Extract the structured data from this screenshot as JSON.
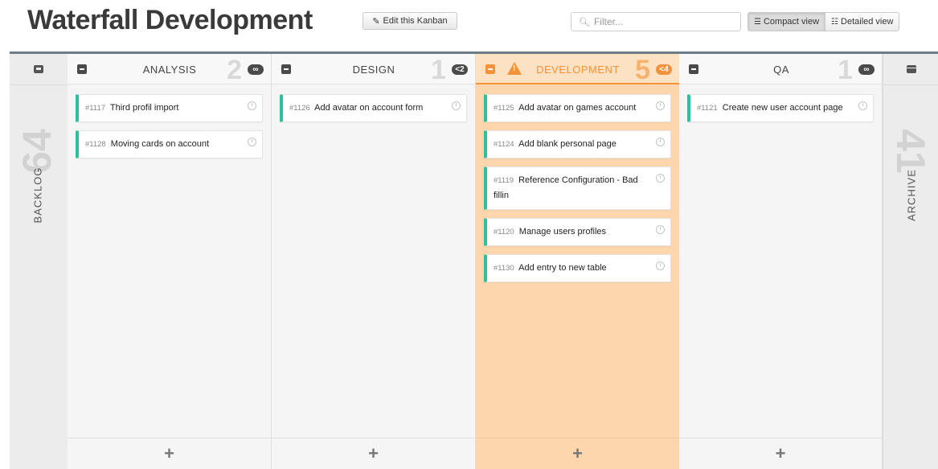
{
  "header": {
    "title": "Waterfall Development",
    "edit_label": "Edit this Kanban",
    "filter_placeholder": "Filter...",
    "views": [
      "Compact view",
      "Detailed view"
    ],
    "active_view": "Compact view"
  },
  "sides": {
    "backlog": {
      "label": "BACKLOG",
      "count": "64",
      "icon": "inbox-icon"
    },
    "archive": {
      "label": "ARCHIVE",
      "count": "41",
      "icon": "archive-icon"
    }
  },
  "columns": [
    {
      "title": "ANALYSIS",
      "count": "2",
      "limit": "∞",
      "cards": [
        {
          "id": "#1117",
          "text": "Third profil import"
        },
        {
          "id": "#1128",
          "text": "Moving cards on account"
        }
      ]
    },
    {
      "title": "DESIGN",
      "count": "1",
      "limit": "<2",
      "cards": [
        {
          "id": "#1126",
          "text": "Add avatar on account form"
        }
      ]
    },
    {
      "title": "DEVELOPMENT",
      "count": "5",
      "limit": "<4",
      "warning": true,
      "cards": [
        {
          "id": "#1125",
          "text": "Add avatar on games account"
        },
        {
          "id": "#1124",
          "text": "Add blank personal page"
        },
        {
          "id": "#1119",
          "text": "Reference Configuration - Bad fillin"
        },
        {
          "id": "#1120",
          "text": "Manage users profiles"
        },
        {
          "id": "#1130",
          "text": "Add entry to new table"
        }
      ]
    },
    {
      "title": "QA",
      "count": "1",
      "limit": "∞",
      "cards": [
        {
          "id": "#1121",
          "text": "Create new user account page"
        }
      ]
    }
  ],
  "colors": {
    "card_accent": "#2fbf9c",
    "warning": "#f2923a",
    "warning_bg": "#fdd6ae"
  }
}
